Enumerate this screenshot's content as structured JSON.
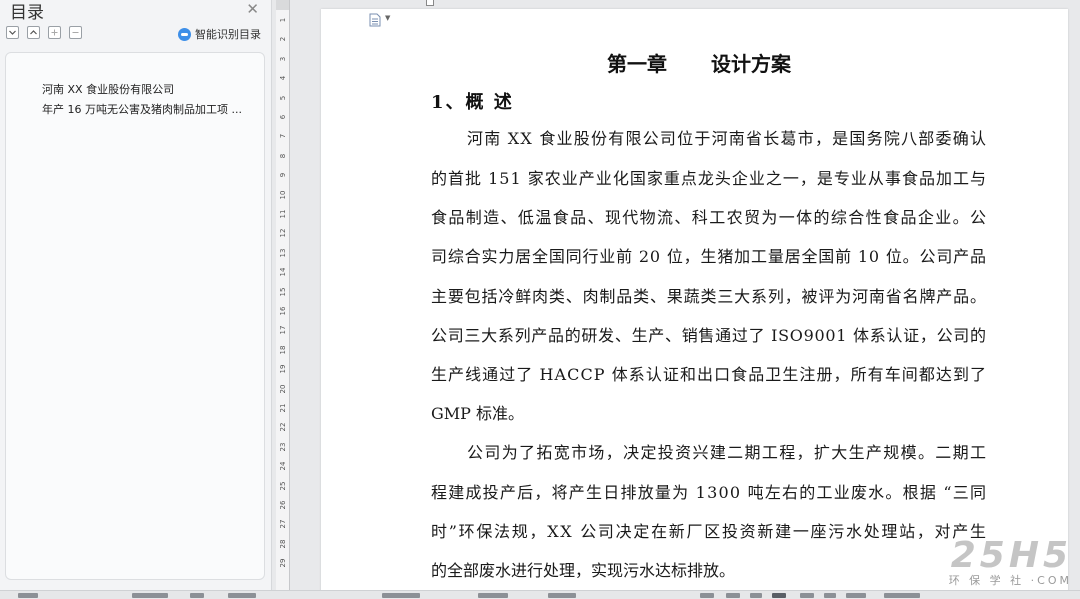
{
  "nav_panel": {
    "title": "目录",
    "smart_toc_label": "智能识别目录",
    "toc_items": [
      {
        "label": "河南 XX 食业股份有限公司"
      },
      {
        "label": "年产 16 万吨无公害及猪肉制品加工项 ..."
      }
    ]
  },
  "ruler": {
    "numbers": [
      "1",
      "2",
      "3",
      "4",
      "5",
      "6",
      "7",
      "8",
      "9",
      "10",
      "11",
      "12",
      "13",
      "14",
      "15",
      "16",
      "17",
      "18",
      "19",
      "20",
      "21",
      "22",
      "23",
      "24",
      "25",
      "26",
      "27",
      "28",
      "29"
    ]
  },
  "document": {
    "chapter_left": "第一章",
    "chapter_right": "设计方案",
    "section_heading": "1、概 述",
    "lines": [
      "河南 XX 食业股份有限公司位于河南省长葛市，是国务院八部委确认",
      "的首批 151 家农业产业化国家重点龙头企业之一，是专业从事食品加工与",
      "食品制造、低温食品、现代物流、科工农贸为一体的综合性食品企业。公",
      "司综合实力居全国同行业前 20 位，生猪加工量居全国前 10 位。公司产品",
      "主要包括冷鲜肉类、肉制品类、果蔬类三大系列，被评为河南省名牌产品。",
      "公司三大系列产品的研发、生产、销售通过了 ISO9001 体系认证，公司的",
      "生产线通过了 HACCP 体系认证和出口食品卫生注册，所有车间都达到了",
      "GMP 标准。",
      "公司为了拓宽市场，决定投资兴建二期工程，扩大生产规模。二期工",
      "程建成投产后，将产生日排放量为 1300 吨左右的工业废水。根据 “三同",
      "时”环保法规，XX 公司决定在新厂区投资新建一座污水处理站，对产生",
      "的全部废水进行处理，实现污水达标排放。"
    ]
  },
  "watermark": {
    "logo": "25H5",
    "sub": "环 保 学 社 ·COM"
  },
  "colors": {
    "panel_bg": "#f3f4f6",
    "page_bg": "#ffffff",
    "accent_blue": "#3e8fe8"
  }
}
